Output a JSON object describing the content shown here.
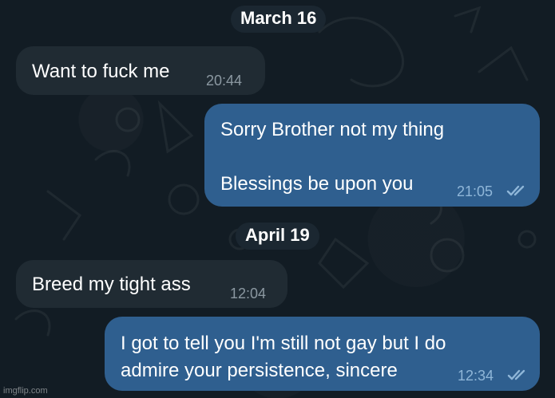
{
  "conversation": {
    "dates": [
      "March 16",
      "April 19"
    ],
    "messages": [
      {
        "direction": "incoming",
        "lines": [
          "Want to fuck me"
        ],
        "time": "20:44"
      },
      {
        "direction": "outgoing",
        "lines": [
          "Sorry Brother not my thing",
          "",
          "Blessings be upon you"
        ],
        "time": "21:05",
        "status": "read-double-check-icon"
      },
      {
        "direction": "incoming",
        "lines": [
          "Breed my tight ass"
        ],
        "time": "12:04"
      },
      {
        "direction": "outgoing",
        "lines": [
          "I got to tell you I'm still not gay but I do",
          "admire your persistence, sincere"
        ],
        "time": "12:34",
        "status": "read-double-check-icon"
      }
    ]
  },
  "watermark": "imgflip.com",
  "colors": {
    "background": "#121c24",
    "incoming_bubble": "#202b33",
    "outgoing_bubble": "#2f5f8f",
    "date_chip": "#1b2731",
    "read_ticks": "#8fb6d8"
  }
}
